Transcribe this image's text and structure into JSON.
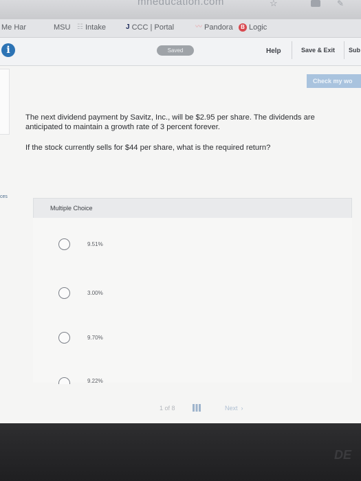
{
  "browser": {
    "url_fragment": "mheducation.com",
    "bookmarks": [
      {
        "label": "Me Har",
        "icon": ""
      },
      {
        "label": "MSU",
        "icon": ""
      },
      {
        "label": "Intake",
        "icon": "list-icon"
      },
      {
        "label": "CCC | Portal",
        "icon": "j-icon"
      },
      {
        "label": "Pandora",
        "icon": "pandora-icon"
      },
      {
        "label": "Logic",
        "icon": "b-icon"
      }
    ]
  },
  "appbar": {
    "saved_label": "Saved",
    "help_label": "Help",
    "save_exit_label": "Save & Exit",
    "submit_label": "Sub"
  },
  "toolbar": {
    "check_label": "Check my wo"
  },
  "sidebar": {
    "tab_text": "ces"
  },
  "question": {
    "text": "The next dividend payment by Savitz, Inc., will be $2.95 per share. The dividends are anticipated to maintain a growth rate of 3 percent forever.",
    "prompt": "If the stock currently sells for $44 per share, what is the required return?"
  },
  "multiple_choice": {
    "header": "Multiple Choice",
    "options": [
      {
        "label": "9.51%"
      },
      {
        "label": "3.00%"
      },
      {
        "label": "9.70%"
      },
      {
        "label": "9.22%"
      }
    ]
  },
  "pager": {
    "count": "1 of 8",
    "next_label": "Next"
  },
  "colors": {
    "accent": "#2d73b4",
    "check_button": "#a9c3de"
  }
}
